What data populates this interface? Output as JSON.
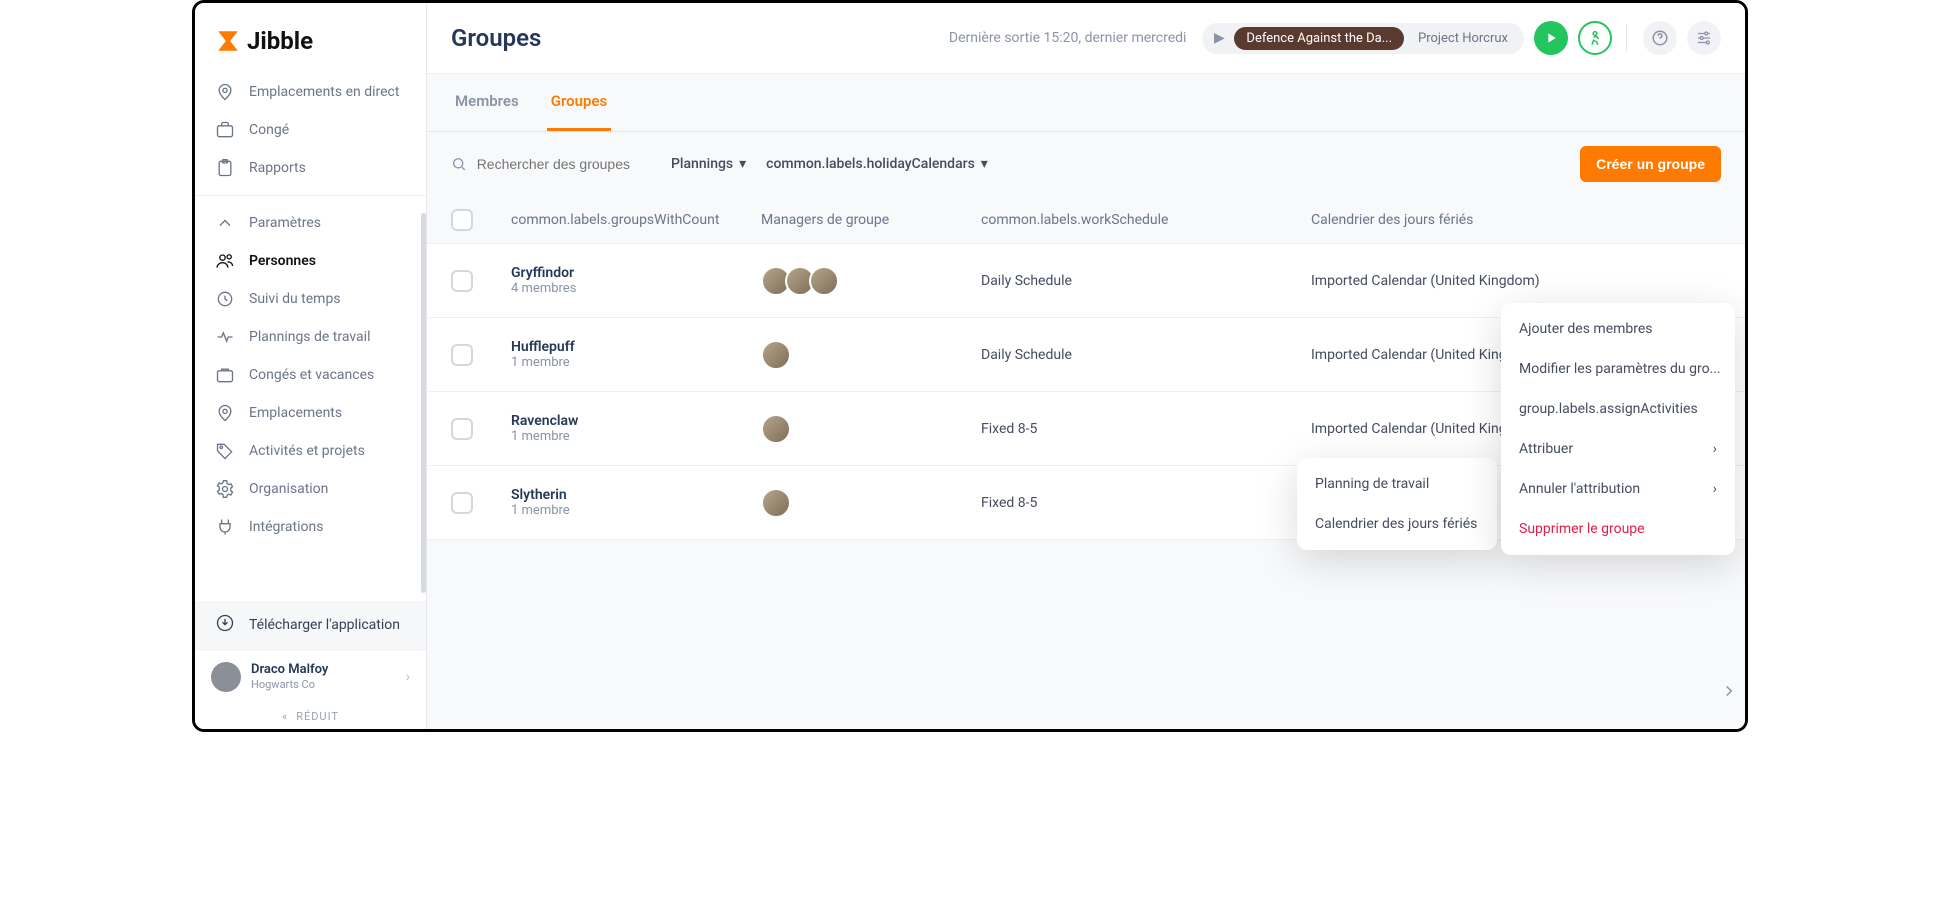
{
  "brand": "Jibble",
  "sidebar": {
    "items": [
      {
        "label": "Emplacements en direct"
      },
      {
        "label": "Congé"
      },
      {
        "label": "Rapports"
      }
    ],
    "settings_label": "Paramètres",
    "secondary": [
      {
        "label": "Personnes",
        "active": true
      },
      {
        "label": "Suivi du temps"
      },
      {
        "label": "Plannings de travail"
      },
      {
        "label": "Congés et vacances"
      },
      {
        "label": "Emplacements"
      },
      {
        "label": "Activités et projets"
      },
      {
        "label": "Organisation"
      },
      {
        "label": "Intégrations"
      }
    ],
    "download_label": "Télécharger l'application",
    "user": {
      "name": "Draco Malfoy",
      "org": "Hogwarts Co"
    },
    "collapse_label": "RÉDUIT"
  },
  "topbar": {
    "title": "Groupes",
    "status": "Dernière sortie 15:20, dernier mercredi",
    "pill_primary": "Defence Against the Da...",
    "pill_secondary": "Project Horcrux"
  },
  "tabs": [
    {
      "label": "Membres"
    },
    {
      "label": "Groupes",
      "active": true
    }
  ],
  "filters": {
    "search_placeholder": "Rechercher des groupes",
    "schedule_label": "Plannings",
    "holiday_label": "common.labels.holidayCalendars",
    "create_label": "Créer un groupe"
  },
  "columns": {
    "c1": "common.labels.groupsWithCount",
    "c2": "Managers de groupe",
    "c3": "common.labels.workSchedule",
    "c4": "Calendrier des jours fériés"
  },
  "rows": [
    {
      "name": "Gryffindor",
      "sub": "4 membres",
      "avatars": 3,
      "schedule": "Daily Schedule",
      "calendar": "Imported Calendar (United Kingdom)"
    },
    {
      "name": "Hufflepuff",
      "sub": "1 membre",
      "avatars": 1,
      "schedule": "Daily Schedule",
      "calendar": "Imported Calendar (United Kingdom)"
    },
    {
      "name": "Ravenclaw",
      "sub": "1 membre",
      "avatars": 1,
      "schedule": "Fixed 8-5",
      "calendar": "Imported Calendar (United Kingdom)"
    },
    {
      "name": "Slytherin",
      "sub": "1 membre",
      "avatars": 1,
      "schedule": "Fixed 8-5",
      "calendar": ""
    }
  ],
  "submenu": [
    {
      "label": "Planning de travail"
    },
    {
      "label": "Calendrier des jours fériés"
    }
  ],
  "menu": [
    {
      "label": "Ajouter des membres"
    },
    {
      "label": "Modifier les paramètres du gro..."
    },
    {
      "label": "group.labels.assignActivities"
    },
    {
      "label": "Attribuer",
      "chevron": true
    },
    {
      "label": "Annuler l'attribution",
      "chevron": true
    },
    {
      "label": "Supprimer le groupe",
      "danger": true
    }
  ]
}
